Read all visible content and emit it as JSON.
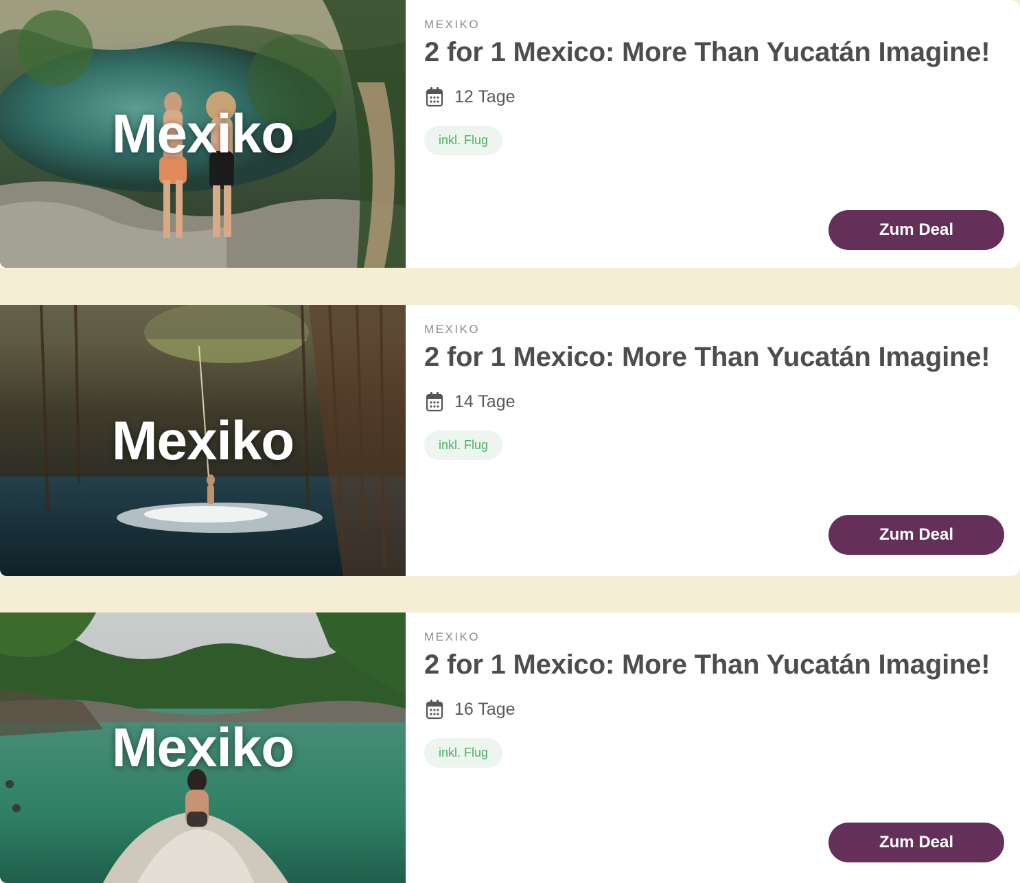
{
  "deals": [
    {
      "image_label": "Mexiko",
      "country": "MEXIKO",
      "title": "2 for 1 Mexico: More Than Yucatán Imagine!",
      "duration": "12 Tage",
      "badge": "inkl. Flug",
      "cta": "Zum Deal"
    },
    {
      "image_label": "Mexiko",
      "country": "MEXIKO",
      "title": "2 for 1 Mexico: More Than Yucatán Imagine!",
      "duration": "14 Tage",
      "badge": "inkl. Flug",
      "cta": "Zum Deal"
    },
    {
      "image_label": "Mexiko",
      "country": "MEXIKO",
      "title": "2 for 1 Mexico: More Than Yucatán Imagine!",
      "duration": "16 Tage",
      "badge": "inkl. Flug",
      "cta": "Zum Deal"
    }
  ],
  "colors": {
    "page_background": "#f6eed4",
    "card_background": "#ffffff",
    "button": "#643059",
    "badge_background": "#ecf6ef",
    "badge_text": "#4fae6c",
    "title": "#4d4d4d"
  },
  "icons": {
    "duration": "calendar-icon"
  }
}
